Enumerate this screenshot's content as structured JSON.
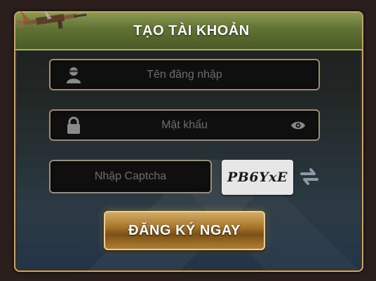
{
  "dialog": {
    "title": "TẠO TÀI KHOẢN"
  },
  "form": {
    "username": {
      "placeholder": "Tên đăng nhập",
      "icon": "user-icon"
    },
    "password": {
      "placeholder": "Mật khẩu",
      "icon": "lock-icon",
      "toggle_icon": "eye-icon"
    },
    "captcha": {
      "placeholder": "Nhập Captcha",
      "code": "PB6YxE",
      "refresh_icon": "refresh-icon"
    },
    "submit_label": "ĐĂNG KÝ NGAY"
  },
  "colors": {
    "header_green": "#5f7133",
    "gold_button": "#a9772c",
    "field_border": "#9b8d78"
  }
}
